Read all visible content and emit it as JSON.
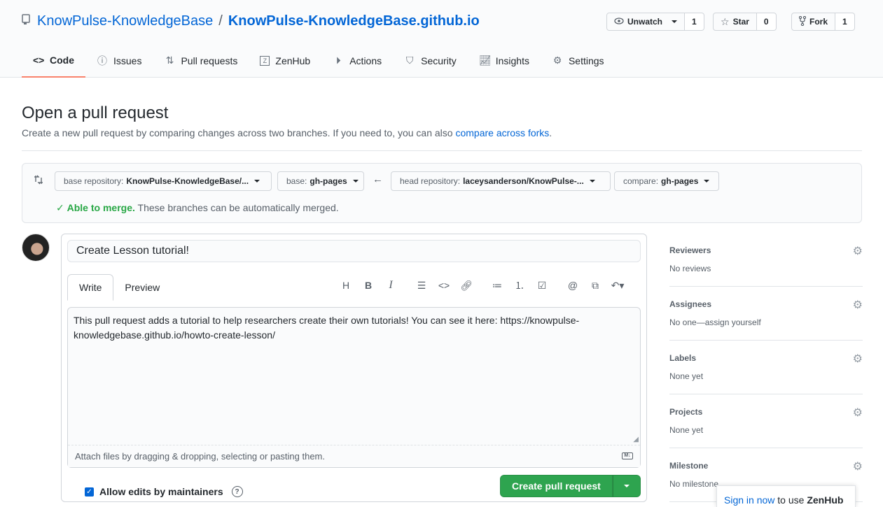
{
  "repo": {
    "owner": "KnowPulse-KnowledgeBase",
    "separator": "/",
    "name": "KnowPulse-KnowledgeBase.github.io"
  },
  "actions": {
    "watch": {
      "label": "Unwatch",
      "count": "1"
    },
    "star": {
      "label": "Star",
      "count": "0"
    },
    "fork": {
      "label": "Fork",
      "count": "1"
    }
  },
  "tabs": [
    {
      "label": "Code",
      "icon": "code-icon"
    },
    {
      "label": "Issues",
      "icon": "issue-icon"
    },
    {
      "label": "Pull requests",
      "icon": "pr-icon"
    },
    {
      "label": "ZenHub",
      "icon": "zenhub-icon"
    },
    {
      "label": "Actions",
      "icon": "play-icon"
    },
    {
      "label": "Security",
      "icon": "shield-icon"
    },
    {
      "label": "Insights",
      "icon": "graph-icon"
    },
    {
      "label": "Settings",
      "icon": "gear-icon"
    }
  ],
  "page": {
    "title": "Open a pull request",
    "subtitle": "Create a new pull request by comparing changes across two branches. If you need to, you can also",
    "subtitle_link": "compare across forks",
    "subtitle_end": "."
  },
  "range": {
    "base_repo_label": "base repository:",
    "base_repo_value": "KnowPulse-KnowledgeBase/...",
    "base_label": "base:",
    "base_value": "gh-pages",
    "head_repo_label": "head repository:",
    "head_repo_value": "laceysanderson/KnowPulse-...",
    "compare_label": "compare:",
    "compare_value": "gh-pages",
    "merge_ok": "Able to merge.",
    "merge_text": "These branches can be automatically merged."
  },
  "composer": {
    "title_value": "Create Lesson tutorial!",
    "tab_write": "Write",
    "tab_preview": "Preview",
    "body_line1": "This pull request adds a tutorial to help researchers create their own tutorials! You can see it here: https://knowpulse-",
    "body_line2": "knowledgebase.github.io/howto-create-lesson/",
    "attach_hint": "Attach files by dragging & dropping, selecting or pasting them.",
    "md_badge": "M↓",
    "allow_edits": "Allow edits by maintainers",
    "submit": "Create pull request"
  },
  "sidebar": [
    {
      "heading": "Reviewers",
      "value": "No reviews"
    },
    {
      "heading": "Assignees",
      "value": "No one—assign yourself"
    },
    {
      "heading": "Labels",
      "value": "None yet"
    },
    {
      "heading": "Projects",
      "value": "None yet"
    },
    {
      "heading": "Milestone",
      "value": "No milestone"
    }
  ],
  "zenhub": {
    "sign_in": "Sign in now",
    "mid": "to use",
    "brand": "ZenHub"
  },
  "colors": {
    "accent": "#0366d6",
    "success": "#2ea44f",
    "tab_underline": "#f9826c"
  }
}
